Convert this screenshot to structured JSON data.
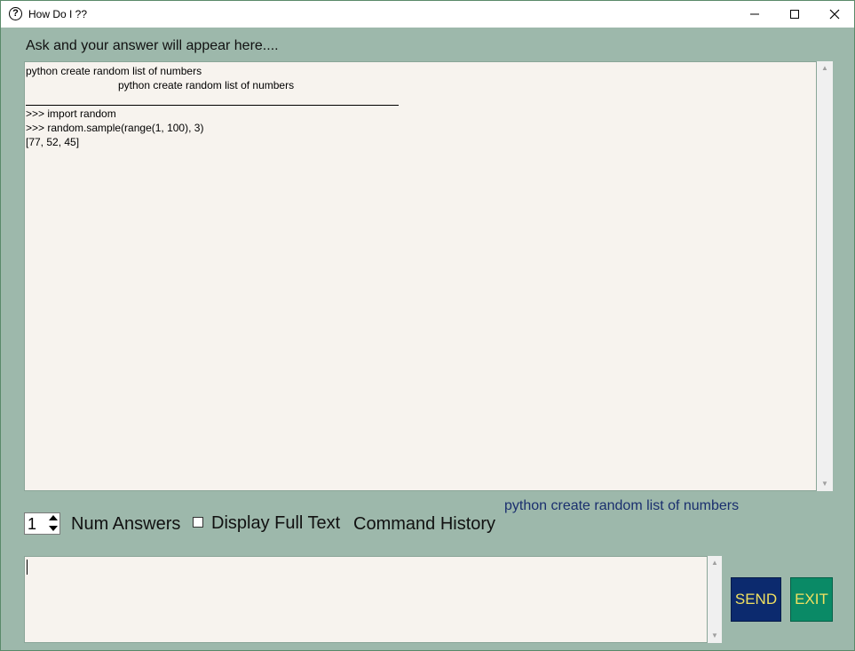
{
  "window": {
    "title": "How Do I ??",
    "icon": "question-circle-icon"
  },
  "header": {
    "label": "Ask and your answer will appear here...."
  },
  "output": {
    "lines": [
      "python create random list of numbers",
      "python create random list of numbers",
      ">>> import random",
      ">>> random.sample(range(1, 100), 3)",
      "[77, 52, 45]"
    ]
  },
  "controls": {
    "num_answers_value": "1",
    "num_answers_label": "Num Answers",
    "display_full_text_label": "Display Full Text",
    "display_full_text_checked": false,
    "command_history_label": "Command History",
    "command_history_items": [
      "python create random list of numbers"
    ]
  },
  "input": {
    "value": ""
  },
  "buttons": {
    "send_label": "SEND",
    "exit_label": "EXIT"
  },
  "colors": {
    "background": "#9db8ab",
    "text_area": "#f7f3ee",
    "send_bg": "#0c2a6e",
    "exit_bg": "#0a8a66",
    "button_text": "#f0e060",
    "history_text": "#1a2f6e"
  }
}
